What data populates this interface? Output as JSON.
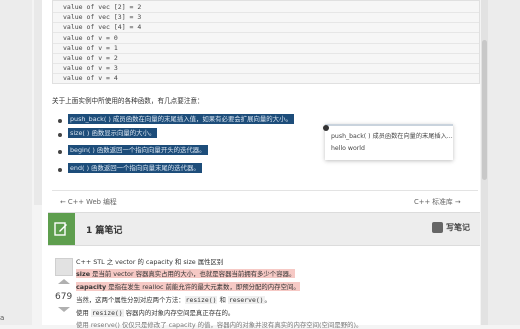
{
  "code_lines": [
    "value of vec [2] = 2",
    "value of vec [3] = 3",
    "value of vec [4] = 4",
    "value of v = 0",
    "value of v = 1",
    "value of v = 2",
    "value of v = 3",
    "value of v = 4"
  ],
  "intro": "关于上面实例中所使用的各种函数，有几点要注意：",
  "bullets": [
    "push_back( ) 成员函数在向量的末尾插入值，如果有必要会扩展向量的大小。",
    "size( ) 函数显示向量的大小。",
    "begin( ) 函数返回一个指向向量开头的迭代器。",
    "end( ) 函数返回一个指向向量末尾的迭代器。"
  ],
  "popup": {
    "line1": "push_back( ) 成员函数在向量的末尾插入...",
    "line2": "hello world"
  },
  "nav": {
    "prev": "← C++ Web 编程",
    "next": "C++ 标准库 →"
  },
  "notes": {
    "title": "1 篇笔记",
    "write": "写笔记",
    "votes": "679"
  },
  "note": {
    "line1": "C++ STL 之 vector 的 capacity 和 size 属性区别",
    "l2_term": "size",
    "l2_text": " 是当前 vector 容器真实占用的大小，也就是容器当前拥有多少个容器。",
    "l3_term": "capacity",
    "l3_text": " 是指在发生 realloc 前能允许的最大元素数，即预分配的内存空间。",
    "l4_pre": "当然，这两个属性分别对应两个方法：",
    "l4_code1": "resize()",
    "l4_mid": " 和 ",
    "l4_code2": "reserve()",
    "l4_post": "。",
    "l5_pre": "使用 ",
    "l5_code": "resize()",
    "l5_post": " 容器内的对象内存空间是真正存在的。",
    "l6": "使用 reserve() 仅仅只是修改了 capacity 的值，容器内的对象并没有真实的内存空间(空间是野的)。"
  },
  "colors": {
    "highlight": "#1d4d7a",
    "notes_accent": "#5e9e4e",
    "note_highlight": "#f6c9c5"
  }
}
